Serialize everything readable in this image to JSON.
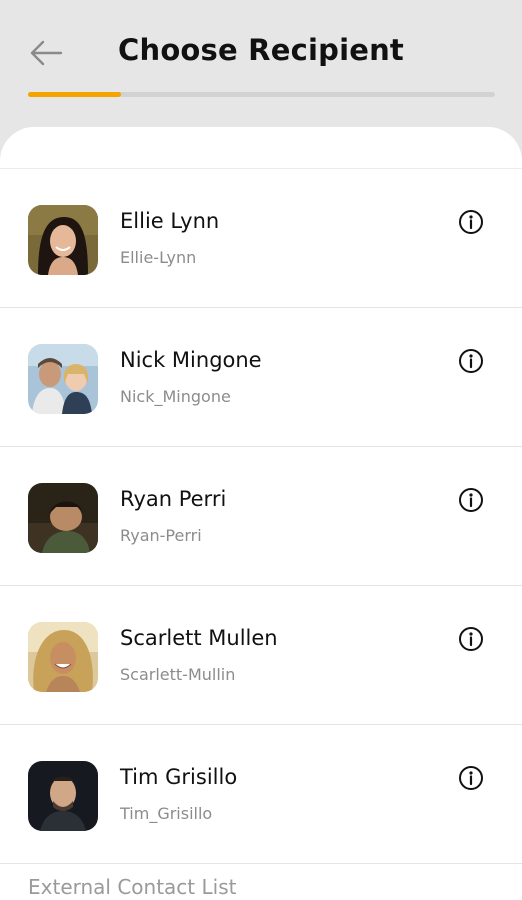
{
  "header": {
    "title": "Choose Recipient",
    "back_icon": "arrow-left-icon",
    "progress_fraction": 0.2,
    "progress_color": "#f5a300"
  },
  "contacts": [
    {
      "name": "Ellie Lynn",
      "username": "Ellie-Lynn",
      "avatar": "photo-woman-dark-hair"
    },
    {
      "name": "Nick Mingone",
      "username": "Nick_Mingone",
      "avatar": "photo-couple-selfie"
    },
    {
      "name": "Ryan Perri",
      "username": "Ryan-Perri",
      "avatar": "photo-man-dark-room"
    },
    {
      "name": "Scarlett Mullen",
      "username": "Scarlett-Mullin",
      "avatar": "photo-woman-curly-blonde"
    },
    {
      "name": "Tim Grisillo",
      "username": "Tim_Grisillo",
      "avatar": "photo-man-dark-background"
    }
  ],
  "info_icon": "info-circle-icon",
  "footer": {
    "external_contacts_label": "External Contact List"
  }
}
